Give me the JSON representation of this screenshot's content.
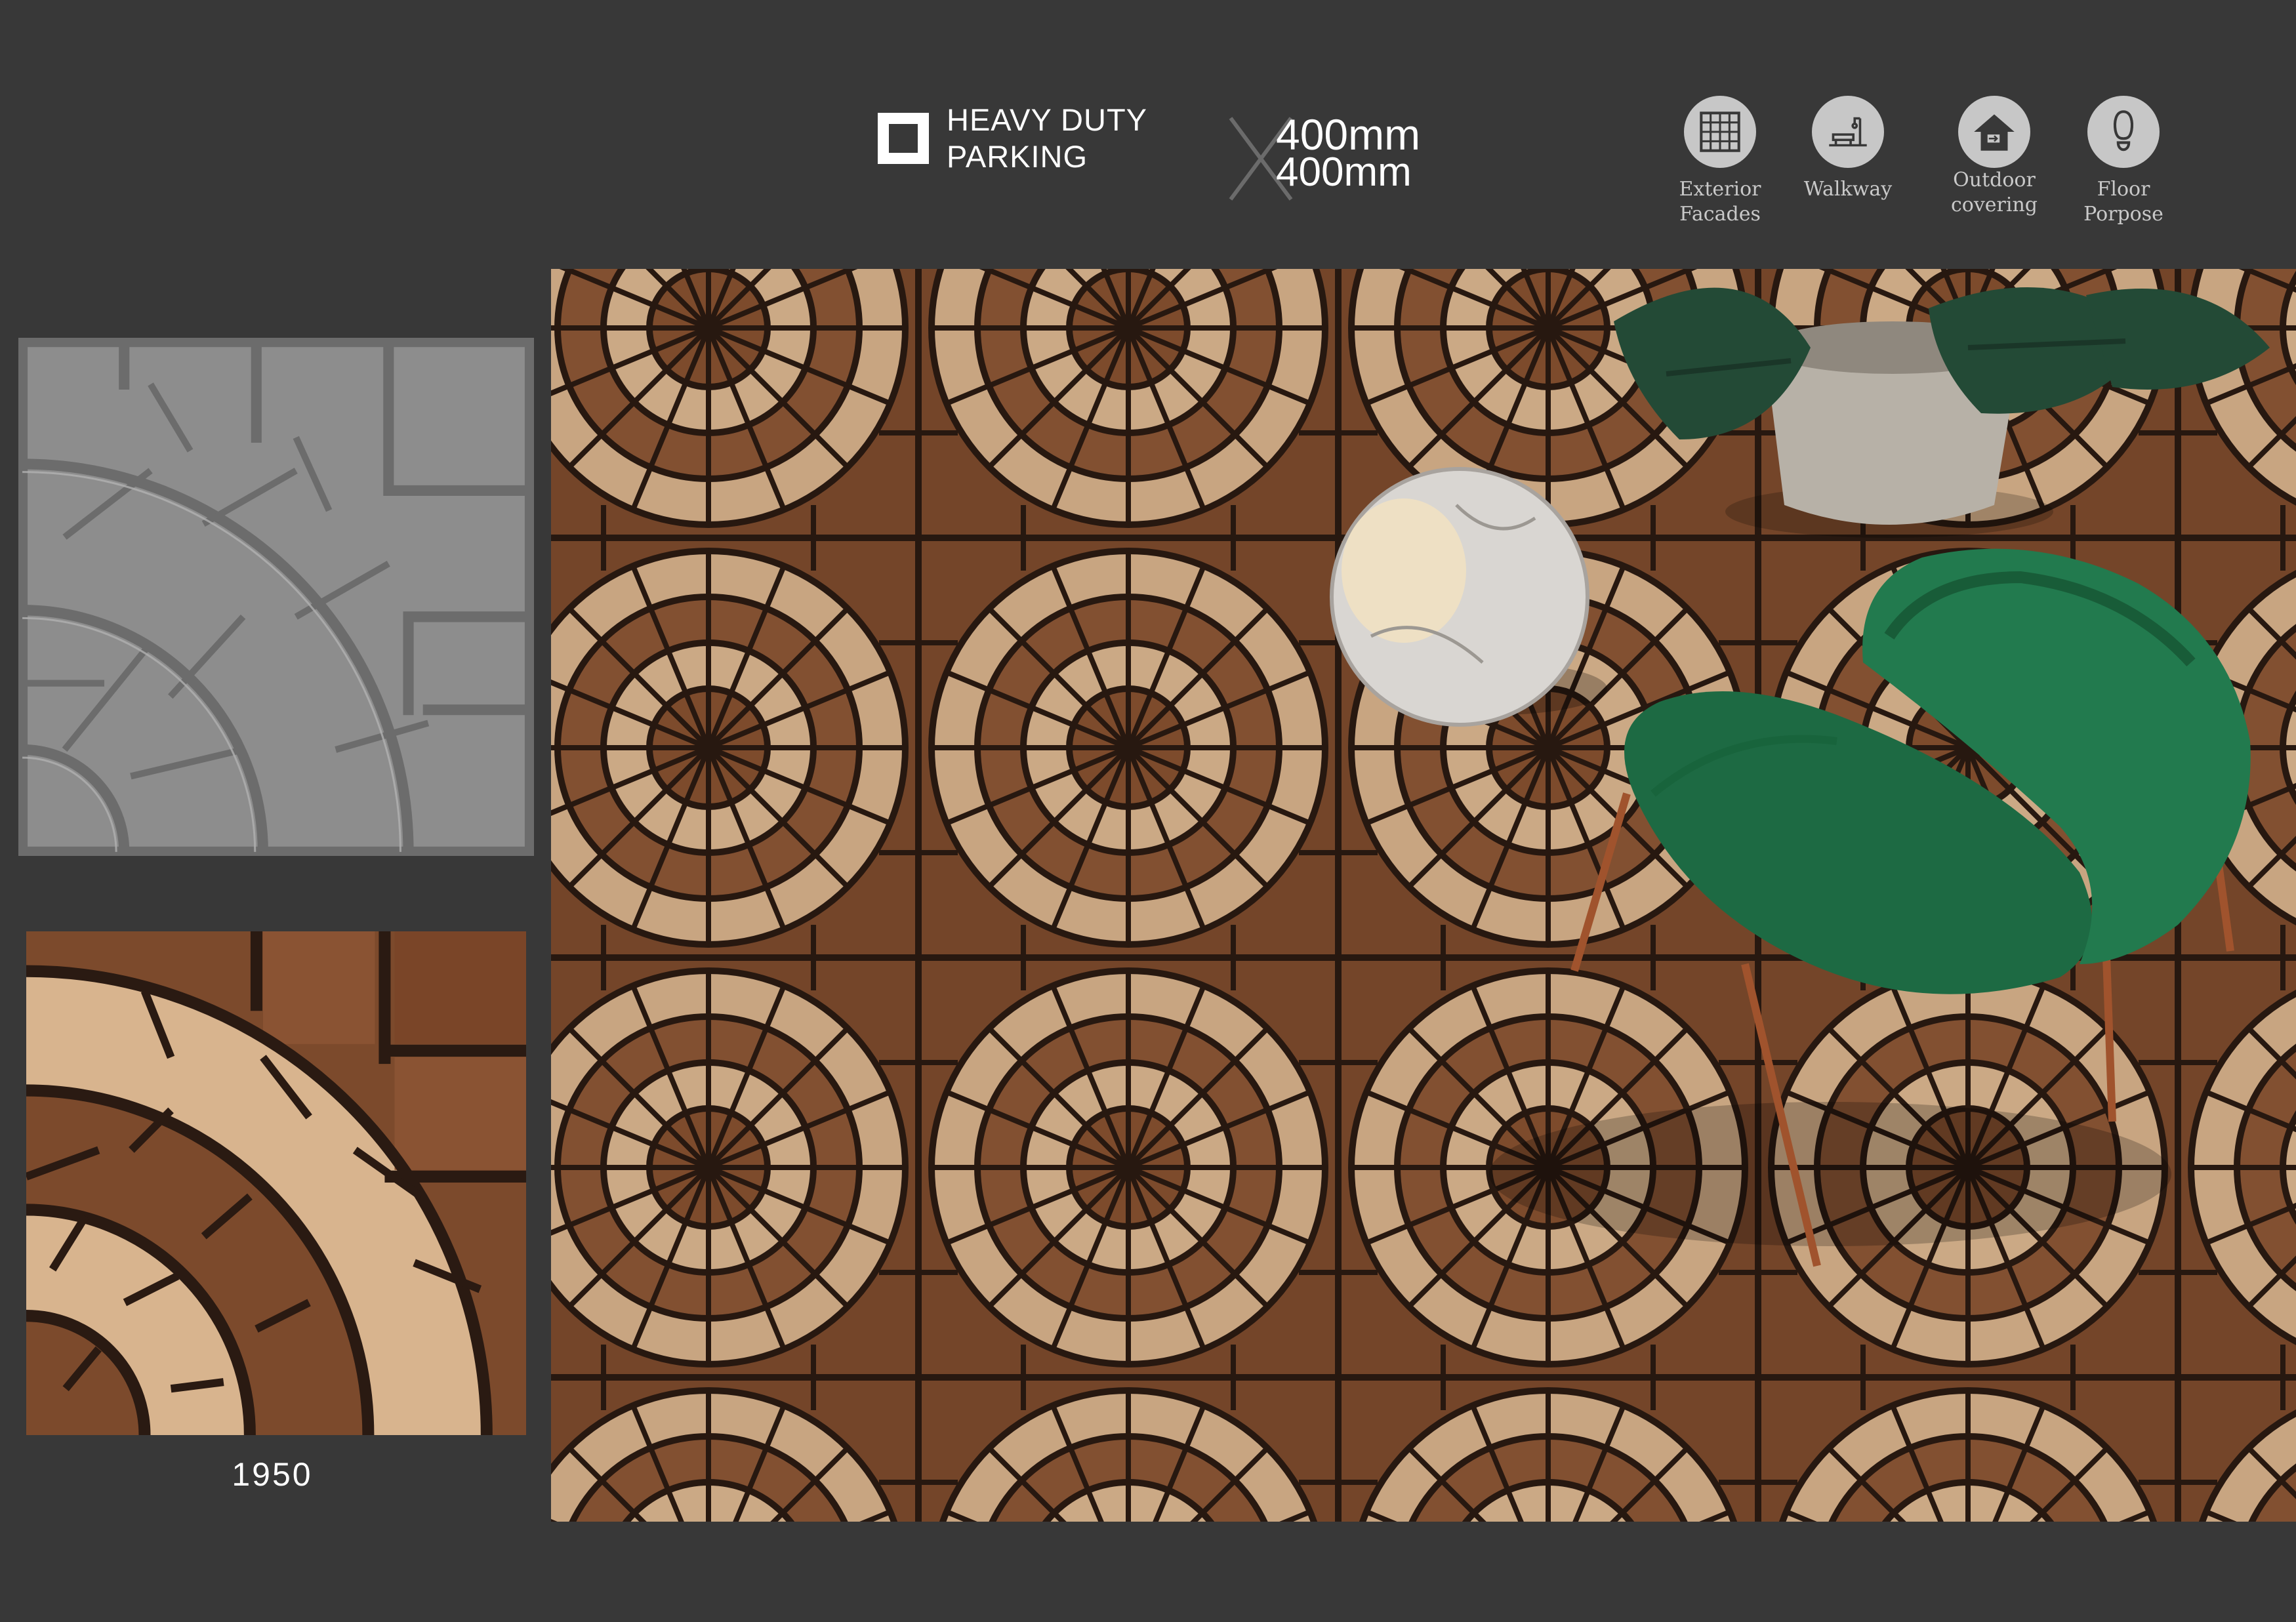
{
  "header": {
    "badge": {
      "line1": "HEAVY DUTY",
      "line2": "PARKING",
      "icon": "square-outline-icon"
    },
    "size": {
      "width": "400mm",
      "height": "400mm",
      "separator_icon": "x-mark-icon"
    },
    "applications": [
      {
        "label_line1": "Exterior",
        "label_line2": "Facades",
        "icon": "grid-wall-icon"
      },
      {
        "label_line1": "Walkway",
        "label_line2": "",
        "icon": "bench-lamp-icon"
      },
      {
        "label_line1": "Outdoor",
        "label_line2": "covering",
        "icon": "house-door-icon"
      },
      {
        "label_line1": "Floor",
        "label_line2": "Porpose",
        "icon": "footprint-icon"
      }
    ]
  },
  "product": {
    "code": "1950"
  },
  "colors": {
    "background": "#383838",
    "tile_dark": "#7c4a2c",
    "tile_light": "#d8b48e",
    "grout": "#2a1a12",
    "gray_tile": "#8d8d8d",
    "chair": "#1f6b45"
  }
}
